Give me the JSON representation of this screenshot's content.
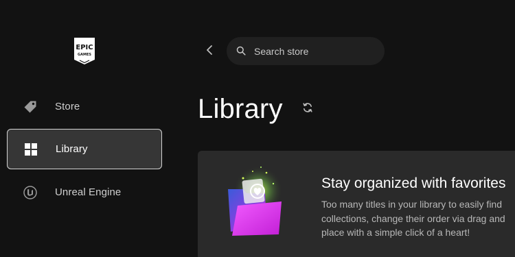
{
  "sidebar": {
    "logo_text": [
      "EPIC",
      "GAMES"
    ],
    "items": [
      {
        "label": "Store",
        "icon": "tag-icon",
        "active": false
      },
      {
        "label": "Library",
        "icon": "grid-icon",
        "active": true
      },
      {
        "label": "Unreal Engine",
        "icon": "unreal-engine-icon",
        "active": false
      }
    ]
  },
  "header": {
    "search": {
      "placeholder": "Search store",
      "value": ""
    }
  },
  "main": {
    "title": "Library",
    "banner": {
      "title": "Stay organized with favorites",
      "text_lines": [
        "Too many titles in your library to easily find",
        "collections, change their order via drag and",
        "place with a simple click of a heart!"
      ]
    }
  },
  "colors": {
    "background": "#121212",
    "active_item": "#363636",
    "search_bg": "#202020",
    "banner_bg": "#2a2a2a",
    "folder_accent": "#e040f0"
  }
}
